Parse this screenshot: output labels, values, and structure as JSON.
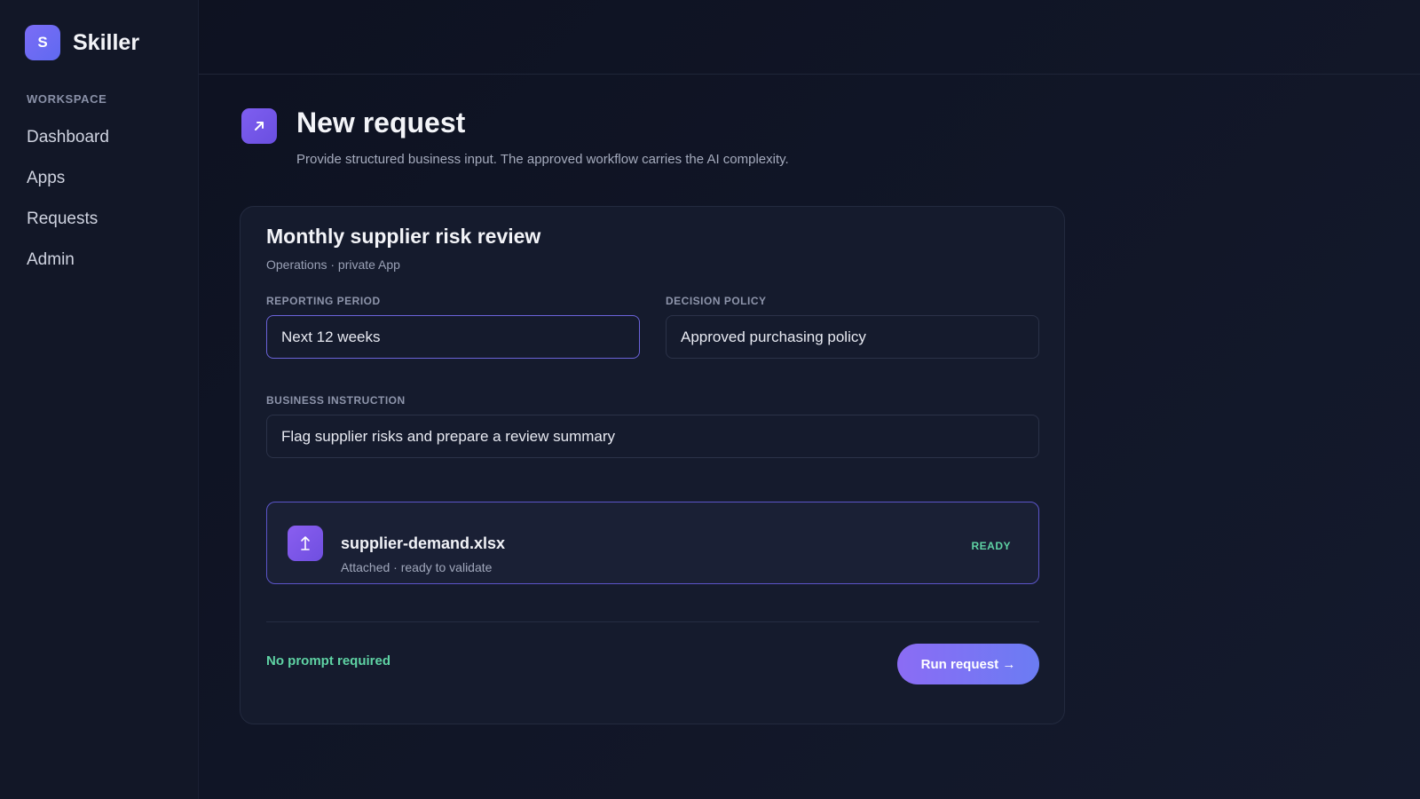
{
  "app": {
    "logo_letter": "S",
    "name": "Skiller"
  },
  "sidebar": {
    "section": "WORKSPACE",
    "items": [
      {
        "label": "Dashboard"
      },
      {
        "label": "Apps"
      },
      {
        "label": "Requests"
      },
      {
        "label": "Admin"
      }
    ]
  },
  "header": {
    "icon": "arrow-up-right-icon",
    "title": "New request",
    "subtitle": "Provide structured business input. The approved workflow carries the AI complexity."
  },
  "card": {
    "title": "Monthly supplier risk review",
    "meta": "Operations · private App",
    "fields": {
      "reporting_period": {
        "label": "REPORTING PERIOD",
        "value": "Next 12 weeks"
      },
      "decision_policy": {
        "label": "DECISION POLICY",
        "value": "Approved purchasing policy"
      },
      "business_instruction": {
        "label": "BUSINESS INSTRUCTION",
        "value": "Flag supplier risks and prepare a review summary"
      }
    },
    "file": {
      "icon": "upload-icon",
      "name": "supplier-demand.xlsx",
      "status": "Attached · ready to validate",
      "badge": "READY"
    },
    "footer": {
      "note": "No prompt required",
      "run_label": "Run request →"
    }
  },
  "colors": {
    "accent": "#7b6cf6",
    "success": "#5fd3a4",
    "background": "#0f1322"
  }
}
